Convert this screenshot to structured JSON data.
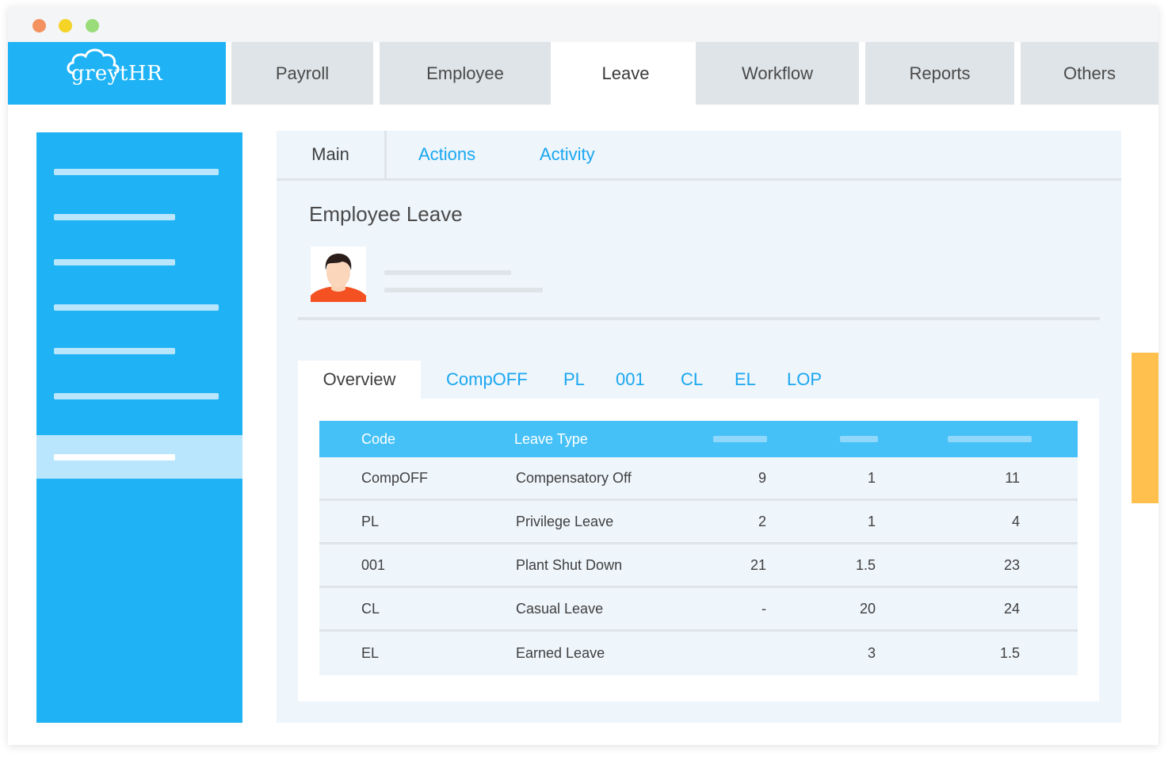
{
  "colors": {
    "brand_blue": "#1fb3f5",
    "header_blue": "#45c1f7",
    "tab_gray": "#dfe4e8",
    "panel_bg": "#eef5fb",
    "link_blue": "#1aa7f0",
    "selected_item": "#b9e6fc",
    "accent_orange": "#ffc04d",
    "dot_red": "#f4925f",
    "dot_yellow": "#f5d327",
    "dot_green": "#9bdc7a"
  },
  "app": {
    "logo_text": "greytHR"
  },
  "top_nav": [
    {
      "label": "Payroll",
      "active": false
    },
    {
      "label": "Employee",
      "active": false
    },
    {
      "label": "Leave",
      "active": true
    },
    {
      "label": "Workflow",
      "active": false
    },
    {
      "label": "Reports",
      "active": false
    },
    {
      "label": "Others",
      "active": false
    }
  ],
  "sub_tabs": [
    {
      "label": "Main",
      "active": true
    },
    {
      "label": "Actions",
      "active": false
    },
    {
      "label": "Activity",
      "active": false
    }
  ],
  "page": {
    "title": "Employee Leave"
  },
  "leave_tabs": [
    {
      "label": "Overview",
      "active": true
    },
    {
      "label": "CompOFF",
      "active": false
    },
    {
      "label": "PL",
      "active": false
    },
    {
      "label": "001",
      "active": false
    },
    {
      "label": "CL",
      "active": false
    },
    {
      "label": "EL",
      "active": false
    },
    {
      "label": "LOP",
      "active": false
    }
  ],
  "table": {
    "headers": [
      "Code",
      "Leave Type"
    ],
    "rows": [
      {
        "code": "CompOFF",
        "type": "Compensatory Off",
        "c3": "9",
        "c4": "1",
        "c5": "11"
      },
      {
        "code": "PL",
        "type": "Privilege Leave",
        "c3": "2",
        "c4": "1",
        "c5": "4"
      },
      {
        "code": "001",
        "type": "Plant Shut Down",
        "c3": "21",
        "c4": "1.5",
        "c5": "23"
      },
      {
        "code": "CL",
        "type": "Casual Leave",
        "c3": "-",
        "c4": "20",
        "c5": "24"
      },
      {
        "code": "EL",
        "type": "Earned Leave",
        "c3": "",
        "c4": "3",
        "c5": "1.5"
      }
    ]
  }
}
